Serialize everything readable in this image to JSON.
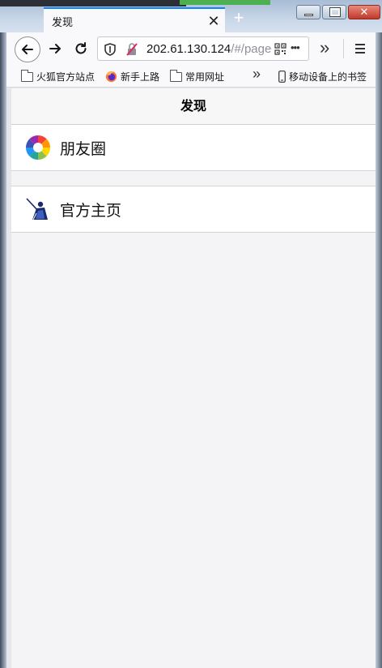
{
  "browser": {
    "tab": {
      "title": "发现",
      "close_glyph": "✕"
    },
    "new_tab_glyph": "+",
    "window_controls": {
      "close_glyph": "✕"
    },
    "url": {
      "host": "202.61.130.124",
      "rest": "/#/page"
    },
    "overflow_glyph": "»",
    "more_glyph": "•••",
    "bookmarks": [
      {
        "label": "火狐官方站点",
        "icon": "folder-icon"
      },
      {
        "label": "新手上路",
        "icon": "firefox-icon"
      },
      {
        "label": "常用网址",
        "icon": "folder-icon"
      }
    ],
    "bookmarks_overflow": "»",
    "mobile_bookmarks": "移动设备上的书签"
  },
  "page": {
    "header_title": "发现",
    "items": [
      {
        "label": "朋友圈",
        "icon": "moments-aperture-icon"
      },
      {
        "label": "官方主页",
        "icon": "samurai-icon"
      }
    ]
  },
  "colors": {
    "accent": "#0a84ff",
    "page_background": "#f4f4f6",
    "cell_background": "#ffffff"
  }
}
